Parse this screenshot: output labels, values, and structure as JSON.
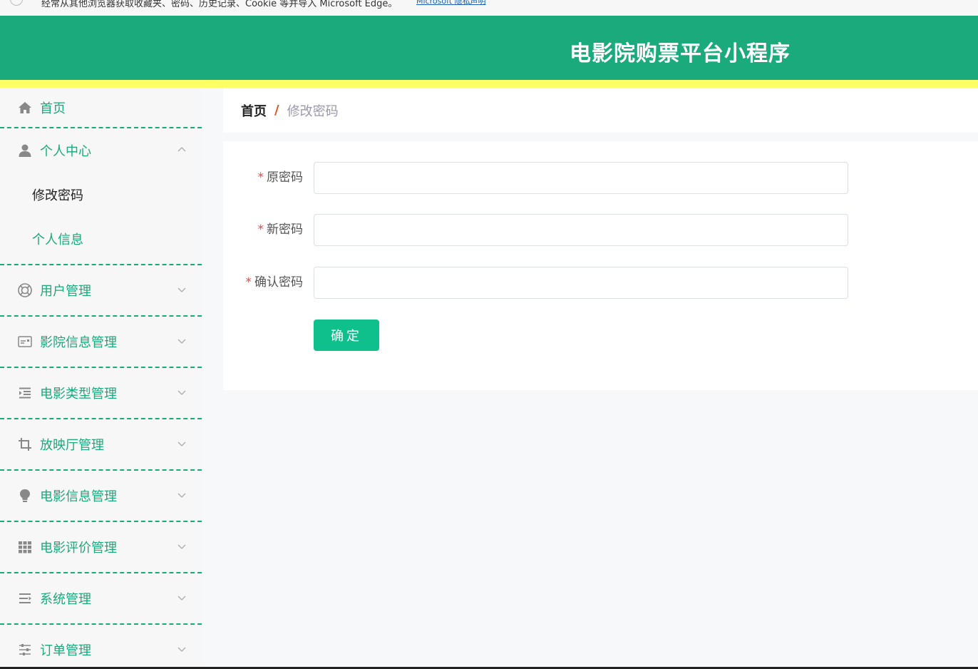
{
  "notice": {
    "text": "经常从其他浏览器获取收藏夹、密码、历史记录、Cookie 等并导入 Microsoft Edge。",
    "link": "Microsoft 隐私声明"
  },
  "header": {
    "title": "电影院购票平台小程序"
  },
  "sidebar": {
    "home": "首页",
    "personal": {
      "label": "个人中心",
      "items": [
        "修改密码",
        "个人信息"
      ]
    },
    "menus": [
      "用户管理",
      "影院信息管理",
      "电影类型管理",
      "放映厅管理",
      "电影信息管理",
      "电影评价管理",
      "系统管理",
      "订单管理"
    ]
  },
  "breadcrumb": {
    "home": "首页",
    "separator": "/",
    "current": "修改密码"
  },
  "form": {
    "required_mark": "*",
    "old_password_label": "原密码",
    "new_password_label": "新密码",
    "confirm_password_label": "确认密码",
    "old_password_value": "",
    "new_password_value": "",
    "confirm_password_value": "",
    "submit_label": "确定"
  },
  "colors": {
    "brand": "#1aaa7b",
    "accent": "#ffff66",
    "button": "#0fbf8c",
    "separator": "#e8501a"
  }
}
